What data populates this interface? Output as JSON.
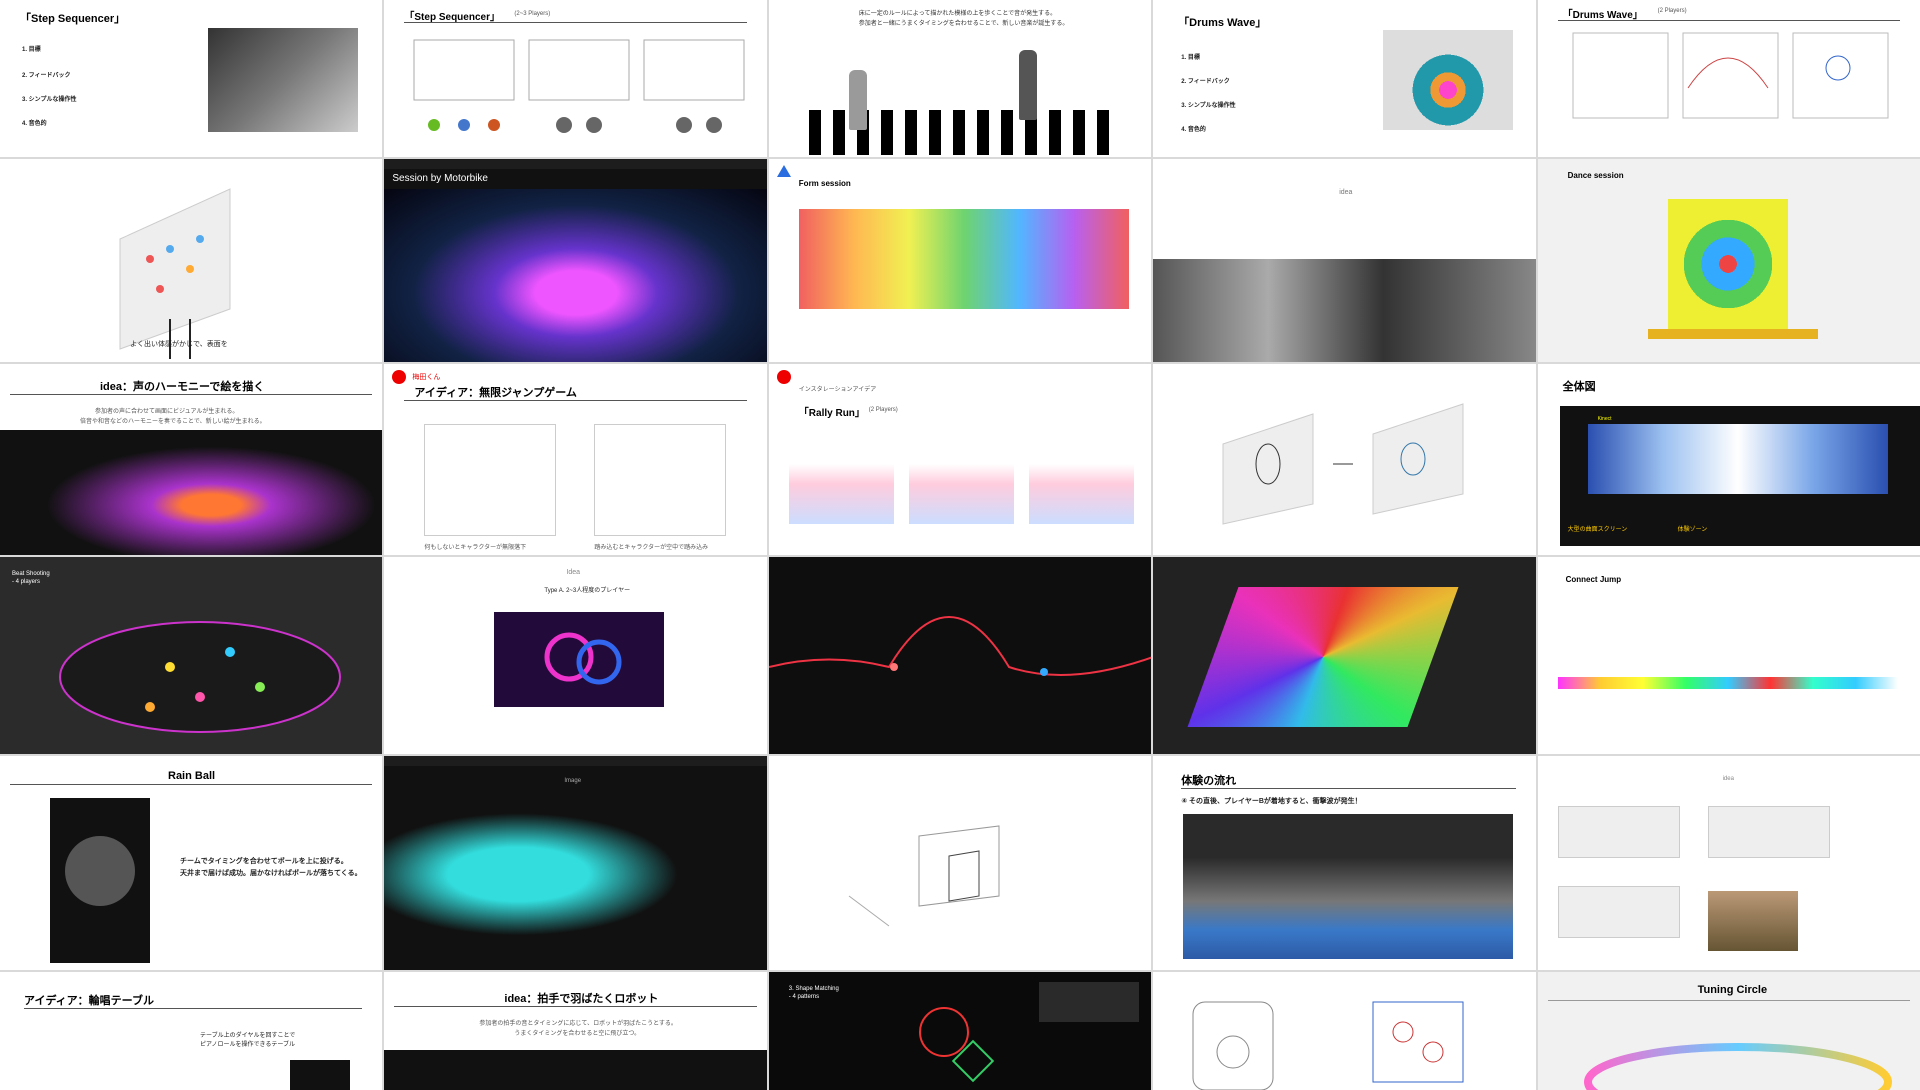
{
  "slides": {
    "r1c1": {
      "title": "「Step Sequencer」",
      "items": [
        "1. 目標",
        "2. フィードバック",
        "3. シンプルな操作性",
        "4. 音色的"
      ]
    },
    "r1c2": {
      "title": "「Step Sequencer」",
      "subtitle": "(2~3 Players)"
    },
    "r1c3": {
      "caption_1": "床に一定のルールによって描かれた模様の上を歩くことで音が発生する。",
      "caption_2": "参加者と一緒にうまくタイミングを合わせることで、新しい音楽が誕生する。"
    },
    "r1c4": {
      "title": "「Drums Wave」",
      "items": [
        "1. 目標",
        "2. フィードバック",
        "3. シンプルな操作性",
        "4. 音色的"
      ]
    },
    "r1c5": {
      "title": "「Drums Wave」",
      "subtitle": "(2 Players)"
    },
    "r2c1": {
      "note": "よく出い体感がかじで、表面を"
    },
    "r2c2": {
      "title": "Session by Motorbike"
    },
    "r2c3": {
      "title": "Form session"
    },
    "r2c4": {
      "title": "idea"
    },
    "r2c5": {
      "title": "Dance session"
    },
    "r3c1": {
      "title": "idea：声のハーモニーで絵を描く",
      "caption_1": "参加者の声に合わせて画面にビジュアルが生まれる。",
      "caption_2": "倍音や和音などのハーモニーを奏でることで、新しい絵が生まれる。"
    },
    "r3c2": {
      "tag": "梅田くん",
      "title": "アイディア：無限ジャンプゲーム",
      "cap_left": "何もしないとキャラクターが無限落下",
      "cap_right": "踏み込むとキャラクターが空中で踏み込み"
    },
    "r3c3": {
      "tag": "インスタレーションアイデア",
      "title": "「Rally Run」",
      "subtitle": "(2 Players)"
    },
    "r3c5": {
      "title": "全体図",
      "label_1": "大型の曲面スクリーン",
      "label_2": "体験ゾーン",
      "kinect": "Kinect"
    },
    "r4c1": {
      "title": "Beat Shooting",
      "subtitle": "- 4 players"
    },
    "r4c2": {
      "title": "Idea",
      "subtitle": "Type A. 2~3人程度のプレイヤー"
    },
    "r4c5": {
      "title": "Connect Jump"
    },
    "r5c1": {
      "title": "Rain Ball",
      "caption_1": "チームでタイミングを合わせてボールを上に投げる。",
      "caption_2": "天井まで届けば成功。届かなければボールが落ちてくる。"
    },
    "r5c2": {
      "title": "Image"
    },
    "r5c4": {
      "title": "体験の流れ",
      "step": "④ その直後、プレイヤーBが着地すると、衝撃波が発生！"
    },
    "r5c5": {
      "title": "idea"
    },
    "r6c1": {
      "title": "アイディア：輪唱テーブル",
      "caption_1": "テーブル上のダイヤルを回すことで",
      "caption_2": "ピアノロールを操作できるテーブル"
    },
    "r6c2": {
      "title": "idea：拍手で羽ばたくロボット",
      "caption_1": "参加者の拍手の音とタイミングに応じて、ロボットが羽ばたこうとする。",
      "caption_2": "うまくタイミングを合わせると空に飛び立つ。"
    },
    "r6c3": {
      "title": "3. Shape Matching",
      "subtitle": "- 4 patterns"
    },
    "r6c5": {
      "title": "Tuning Circle"
    }
  },
  "colors": {
    "accent_red": "#e00000",
    "accent_blue": "#2a6de0",
    "dark_bg": "#111111"
  }
}
